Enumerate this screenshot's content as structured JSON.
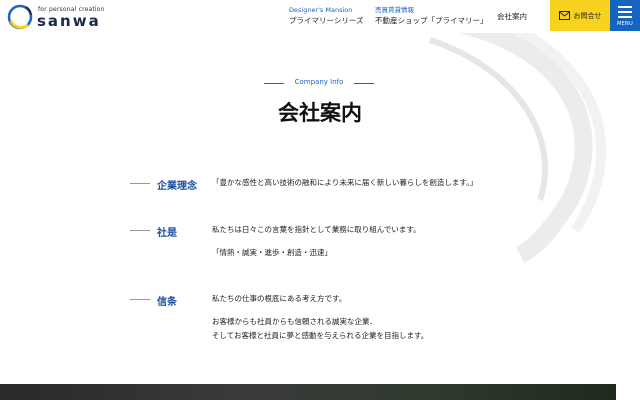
{
  "header": {
    "logo": {
      "tagline": "for personal creation",
      "name": "sanwa"
    },
    "nav": [
      {
        "sub": "Designer's Mansion",
        "main": "プライマリーシリーズ"
      },
      {
        "sub": "売買賃貸情報",
        "main": "不動産ショップ「プライマリー」"
      }
    ],
    "company_link": "会社案内",
    "contact_label": "お問合せ",
    "menu_label": "MENU"
  },
  "section": {
    "subtitle": "Company Info",
    "title": "会社案内"
  },
  "rows": [
    {
      "label": "企業理念",
      "lines": [
        "「豊かな感性と高い技術の融和により未来に届く新しい暮らしを創造します。」"
      ]
    },
    {
      "label": "社是",
      "lines": [
        "私たちは日々この言葉を指針として業務に取り組んでいます。",
        "「情熱・誠実・進歩・創造・迅速」"
      ]
    },
    {
      "label": "信条",
      "lines": [
        "私たちの仕事の根底にある考え方です。",
        "お客様からも社員からも信頼される誠実な企業、",
        "そしてお客様と社員に夢と感動を与えられる企業を目指します。"
      ]
    }
  ],
  "colors": {
    "accent_blue": "#1565c0",
    "contact_yellow": "#f7d21e",
    "label_blue": "#1a4fa0"
  },
  "icons": [
    "logo-mark-icon",
    "mail-icon",
    "menu-icon"
  ]
}
